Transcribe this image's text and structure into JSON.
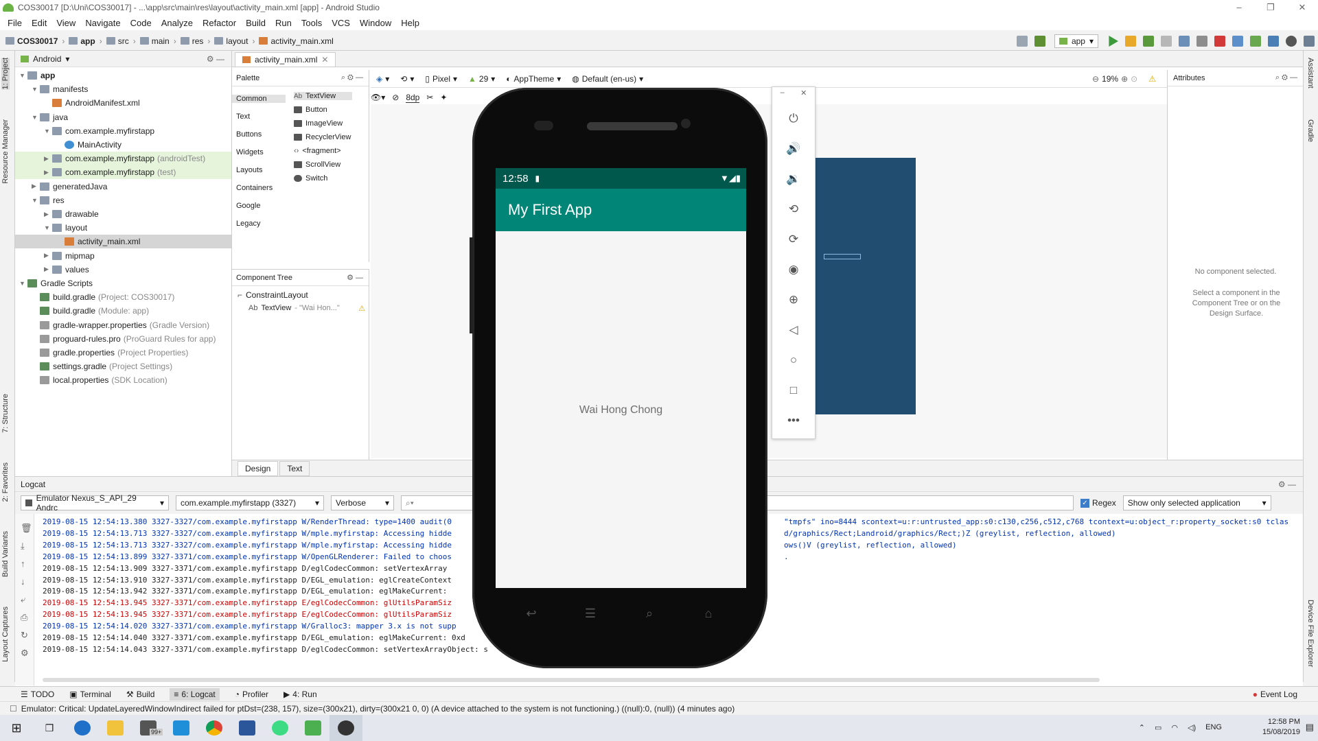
{
  "window": {
    "title": "COS30017 [D:\\Uni\\COS30017] - ...\\app\\src\\main\\res\\layout\\activity_main.xml [app] - Android Studio"
  },
  "menu": [
    "File",
    "Edit",
    "View",
    "Navigate",
    "Code",
    "Analyze",
    "Refactor",
    "Build",
    "Run",
    "Tools",
    "VCS",
    "Window",
    "Help"
  ],
  "breadcrumbs": [
    "COS30017",
    "app",
    "src",
    "main",
    "res",
    "layout",
    "activity_main.xml"
  ],
  "run_config": "app",
  "project": {
    "view": "Android",
    "tree": [
      {
        "label": "app",
        "sub": "",
        "depth": 0,
        "arrow": "▼",
        "icon": "folder-icon"
      },
      {
        "label": "manifests",
        "sub": "",
        "depth": 1,
        "arrow": "▼",
        "icon": "folder-icon"
      },
      {
        "label": "AndroidManifest.xml",
        "sub": "",
        "depth": 2,
        "arrow": "",
        "icon": "xml-icon"
      },
      {
        "label": "java",
        "sub": "",
        "depth": 1,
        "arrow": "▼",
        "icon": "folder-icon"
      },
      {
        "label": "com.example.myfirstapp",
        "sub": "",
        "depth": 2,
        "arrow": "▼",
        "icon": "package-icon"
      },
      {
        "label": "MainActivity",
        "sub": "",
        "depth": 3,
        "arrow": "",
        "icon": "class-icon"
      },
      {
        "label": "com.example.myfirstapp",
        "sub": "(androidTest)",
        "depth": 2,
        "arrow": "▶",
        "icon": "package-icon",
        "hl": true
      },
      {
        "label": "com.example.myfirstapp",
        "sub": "(test)",
        "depth": 2,
        "arrow": "▶",
        "icon": "package-icon",
        "hl": true
      },
      {
        "label": "generatedJava",
        "sub": "",
        "depth": 1,
        "arrow": "▶",
        "icon": "folder-icon"
      },
      {
        "label": "res",
        "sub": "",
        "depth": 1,
        "arrow": "▼",
        "icon": "folder-icon"
      },
      {
        "label": "drawable",
        "sub": "",
        "depth": 2,
        "arrow": "▶",
        "icon": "folder-icon"
      },
      {
        "label": "layout",
        "sub": "",
        "depth": 2,
        "arrow": "▼",
        "icon": "folder-icon"
      },
      {
        "label": "activity_main.xml",
        "sub": "",
        "depth": 3,
        "arrow": "",
        "icon": "layout-icon",
        "sel": true
      },
      {
        "label": "mipmap",
        "sub": "",
        "depth": 2,
        "arrow": "▶",
        "icon": "folder-icon"
      },
      {
        "label": "values",
        "sub": "",
        "depth": 2,
        "arrow": "▶",
        "icon": "folder-icon"
      },
      {
        "label": "Gradle Scripts",
        "sub": "",
        "depth": 0,
        "arrow": "▼",
        "icon": "gradle-icon"
      },
      {
        "label": "build.gradle",
        "sub": "(Project: COS30017)",
        "depth": 1,
        "arrow": "",
        "icon": "gradle-icon"
      },
      {
        "label": "build.gradle",
        "sub": "(Module: app)",
        "depth": 1,
        "arrow": "",
        "icon": "gradle-icon"
      },
      {
        "label": "gradle-wrapper.properties",
        "sub": "(Gradle Version)",
        "depth": 1,
        "arrow": "",
        "icon": "props-icon"
      },
      {
        "label": "proguard-rules.pro",
        "sub": "(ProGuard Rules for app)",
        "depth": 1,
        "arrow": "",
        "icon": "props-icon"
      },
      {
        "label": "gradle.properties",
        "sub": "(Project Properties)",
        "depth": 1,
        "arrow": "",
        "icon": "props-icon"
      },
      {
        "label": "settings.gradle",
        "sub": "(Project Settings)",
        "depth": 1,
        "arrow": "",
        "icon": "gradle-icon"
      },
      {
        "label": "local.properties",
        "sub": "(SDK Location)",
        "depth": 1,
        "arrow": "",
        "icon": "props-icon"
      }
    ]
  },
  "left_tabs": [
    "1: Project",
    "Resource Manager",
    "7: Structure",
    "2: Favorites",
    "Build Variants",
    "Layout Captures"
  ],
  "right_tabs": [
    "Assistant",
    "Gradle",
    "Device File Explorer"
  ],
  "editor": {
    "tab": "activity_main.xml"
  },
  "palette": {
    "title": "Palette",
    "categories": [
      "Common",
      "Text",
      "Buttons",
      "Widgets",
      "Layouts",
      "Containers",
      "Google",
      "Legacy"
    ],
    "items": [
      "TextView",
      "Button",
      "ImageView",
      "RecyclerView",
      "<fragment>",
      "ScrollView",
      "Switch"
    ]
  },
  "component_tree": {
    "title": "Component Tree",
    "root": "ConstraintLayout",
    "child": "TextView",
    "child_hint": "- \"Wai Hon...\""
  },
  "design_toolbar": {
    "device": "Pixel",
    "api": "29",
    "theme": "AppTheme",
    "locale": "Default (en-us)",
    "zoom": "19%",
    "margin": "8dp"
  },
  "attributes": {
    "title": "Attributes",
    "empty": "No component selected.",
    "hint": "Select a component in the Component Tree or on the Design Surface."
  },
  "design_tabs": [
    "Design",
    "Text"
  ],
  "phone": {
    "time": "12:58",
    "app_title": "My First App",
    "text": "Wai Hong Chong"
  },
  "logcat": {
    "title": "Logcat",
    "device": "Emulator Nexus_S_API_29 Andrc",
    "process": "com.example.myfirstapp (3327)",
    "level": "Verbose",
    "regex_label": "Regex",
    "filter": "Show only selected application",
    "lines": [
      {
        "t": "2019-08-15 12:54:13.380 3327-3327/com.example.myfirstapp W/RenderThread: type=1400 audit(0",
        "tail": "\"tmpfs\" ino=8444 scontext=u:r:untrusted_app:s0:c130,c256,c512,c768 tcontext=u:object_r:property_socket:s0 tclas",
        "c": "lw"
      },
      {
        "t": "2019-08-15 12:54:13.713 3327-3327/com.example.myfirstapp W/mple.myfirstap: Accessing hidde",
        "tail": "d/graphics/Rect;Landroid/graphics/Rect;)Z (greylist, reflection, allowed)",
        "c": "lw"
      },
      {
        "t": "2019-08-15 12:54:13.713 3327-3327/com.example.myfirstapp W/mple.myfirstap: Accessing hidde",
        "tail": "ows()V (greylist, reflection, allowed)",
        "c": "lw"
      },
      {
        "t": "2019-08-15 12:54:13.899 3327-3371/com.example.myfirstapp W/OpenGLRenderer: Failed to choos",
        "tail": ".",
        "c": "lw"
      },
      {
        "t": "2019-08-15 12:54:13.909 3327-3371/com.example.myfirstapp D/eglCodecCommon: setVertexArray",
        "tail": "",
        "c": "ld"
      },
      {
        "t": "2019-08-15 12:54:13.910 3327-3371/com.example.myfirstapp D/EGL_emulation: eglCreateContext",
        "tail": "",
        "c": "ld"
      },
      {
        "t": "2019-08-15 12:54:13.942 3327-3371/com.example.myfirstapp D/EGL_emulation: eglMakeCurrent:",
        "tail": "",
        "c": "ld"
      },
      {
        "t": "2019-08-15 12:54:13.945 3327-3371/com.example.myfirstapp E/eglCodecCommon: glUtilsParamSiz",
        "tail": "",
        "c": "le"
      },
      {
        "t": "2019-08-15 12:54:13.945 3327-3371/com.example.myfirstapp E/eglCodecCommon: glUtilsParamSiz",
        "tail": "",
        "c": "le"
      },
      {
        "t": "2019-08-15 12:54:14.020 3327-3371/com.example.myfirstapp W/Gralloc3: mapper 3.x is not supp",
        "tail": "",
        "c": "lw"
      },
      {
        "t": "2019-08-15 12:54:14.040 3327-3371/com.example.myfirstapp D/EGL_emulation: eglMakeCurrent: 0xd",
        "tail": "",
        "c": "ld"
      },
      {
        "t": "2019-08-15 12:54:14.043 3327-3371/com.example.myfirstapp D/eglCodecCommon: setVertexArrayObject: s",
        "tail": "",
        "c": "ld"
      }
    ]
  },
  "bottom_tabs": [
    "TODO",
    "Terminal",
    "Build",
    "6: Logcat",
    "Profiler",
    "4: Run"
  ],
  "event_log": "Event Log",
  "status": "Emulator: Critical: UpdateLayeredWindowIndirect failed for ptDst=(238, 157), size=(300x21), dirty=(300x21 0, 0) (A device attached to the system is not functioning.) ((null):0, (null)) (4 minutes ago)",
  "taskbar": {
    "lang": "ENG",
    "time": "12:58 PM",
    "date": "15/08/2019",
    "badge": "99+"
  }
}
